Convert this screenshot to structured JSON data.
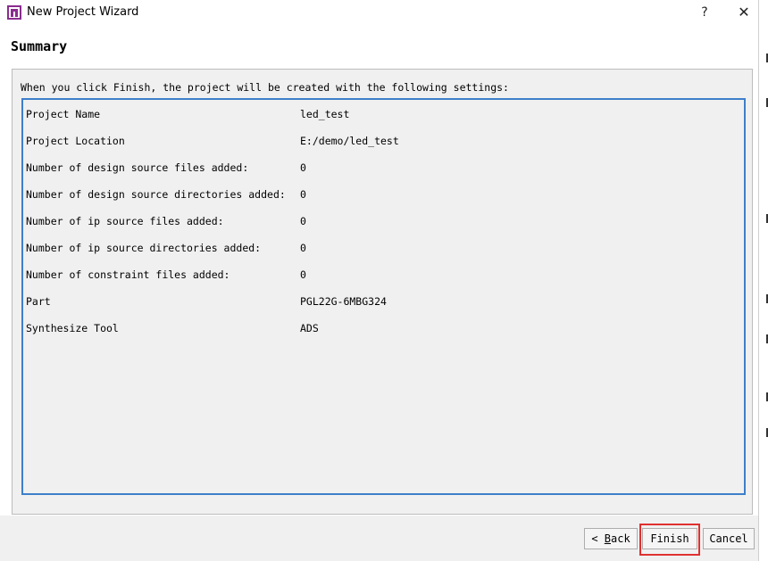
{
  "window": {
    "title": "New Project Wizard",
    "help_label": "?",
    "close_label": "✕"
  },
  "page": {
    "title": "Summary",
    "intro": "When you click Finish, the project will be created with the following settings:"
  },
  "settings": [
    {
      "label": "Project Name",
      "value": "led_test"
    },
    {
      "label": "Project Location",
      "value": "E:/demo/led_test"
    },
    {
      "label": "Number of design source files added:",
      "value": "0"
    },
    {
      "label": "Number of design source directories added:",
      "value": "0"
    },
    {
      "label": "Number of ip source files added:",
      "value": "0"
    },
    {
      "label": "Number of ip source directories added:",
      "value": "0"
    },
    {
      "label": "Number of constraint files added:",
      "value": "0"
    },
    {
      "label": "Part",
      "value": "PGL22G-6MBG324"
    },
    {
      "label": "Synthesize Tool",
      "value": "ADS"
    }
  ],
  "buttons": {
    "back_prefix": "< ",
    "back_mnemonic": "B",
    "back_rest": "ack",
    "finish_label": "Finish",
    "cancel_label": "Cancel"
  },
  "colors": {
    "accent_border": "#3d7fc9",
    "highlight": "#e03030",
    "app_icon": "#8a2c8f"
  },
  "icons": {
    "app": "app-logo-icon",
    "help": "help-icon",
    "close": "close-icon"
  }
}
